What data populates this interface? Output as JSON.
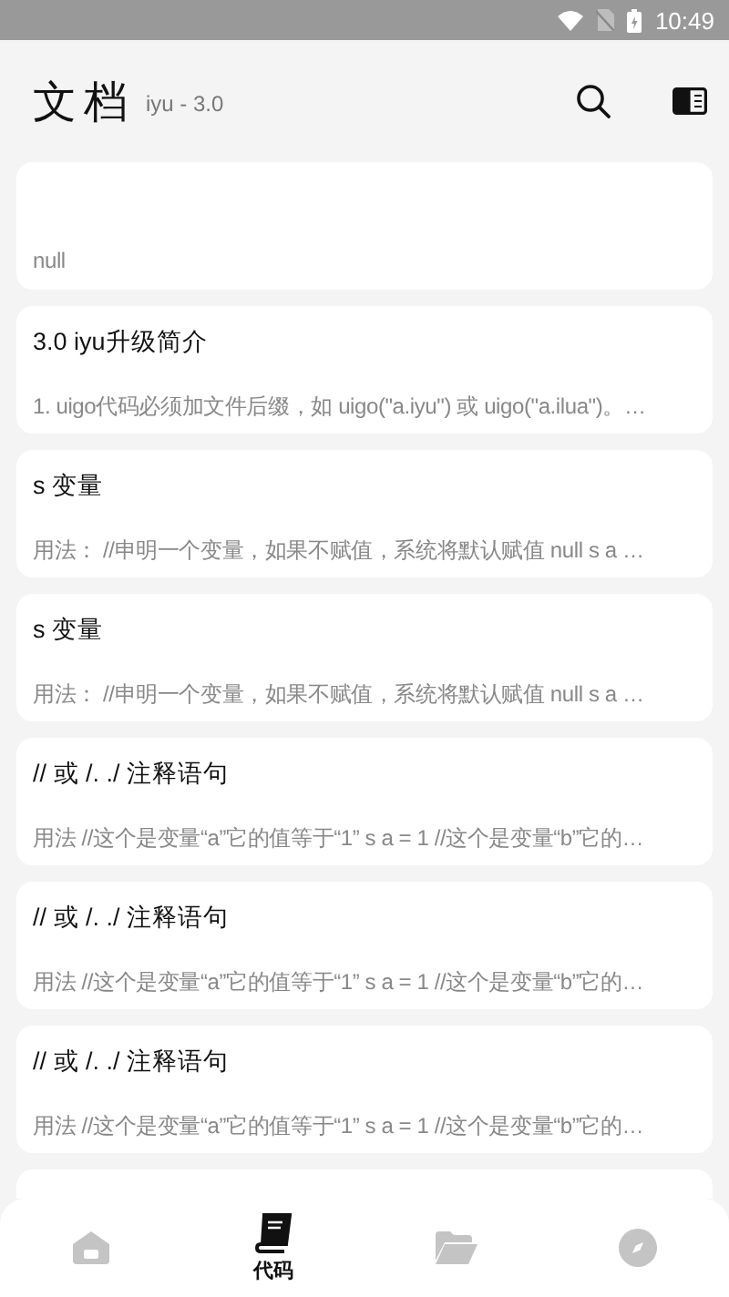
{
  "status_bar": {
    "time": "10:49"
  },
  "header": {
    "title": "文档",
    "subtitle": "iyu - 3.0"
  },
  "cards": [
    {
      "description": "null"
    },
    {
      "title": "3.0 iyu升级简介",
      "description": "1. uigo代码必须加文件后缀，如 uigo(\"a.iyu\") 或 uigo(\"a.ilua\")。…"
    },
    {
      "title": "s 变量",
      "description": "用法：  //申明一个变量，如果不赋值，系统将默认赋值 null s a  …"
    },
    {
      "title": "s 变量",
      "description": "用法：  //申明一个变量，如果不赋值，系统将默认赋值 null s a  …"
    },
    {
      "title": "// 或 /. ./ 注释语句",
      "description": "用法 //这个是变量“a”它的值等于“1” s a = 1 //这个是变量“b”它的…"
    },
    {
      "title": "// 或 /. ./ 注释语句",
      "description": "用法 //这个是变量“a”它的值等于“1” s a = 1 //这个是变量“b”它的…"
    },
    {
      "title": "// 或 /. ./ 注释语句",
      "description": "用法 //这个是变量“a”它的值等于“1” s a = 1 //这个是变量“b”它的…"
    }
  ],
  "bottom_nav": [
    {
      "kind": "home",
      "selected": false
    },
    {
      "kind": "book",
      "label": "代码",
      "selected": true
    },
    {
      "kind": "folder",
      "selected": false
    },
    {
      "kind": "compass",
      "selected": false
    }
  ]
}
